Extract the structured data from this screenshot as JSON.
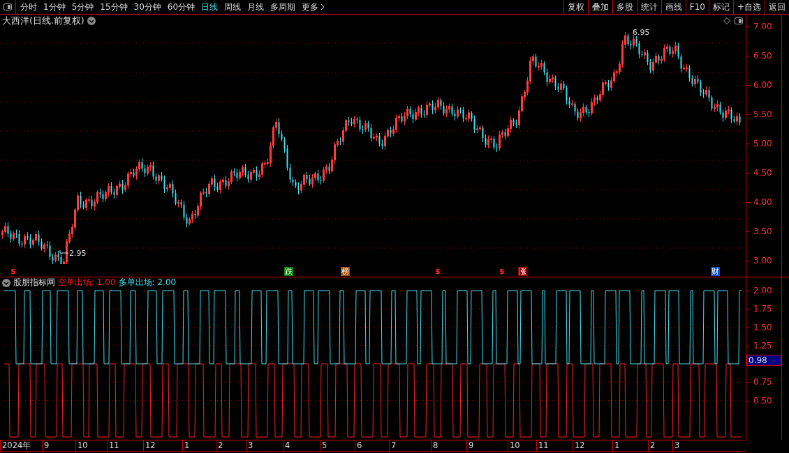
{
  "toolbar": {
    "periods": [
      {
        "label": "分时",
        "selected": false
      },
      {
        "label": "1分钟",
        "selected": false
      },
      {
        "label": "5分钟",
        "selected": false
      },
      {
        "label": "15分钟",
        "selected": false
      },
      {
        "label": "30分钟",
        "selected": false
      },
      {
        "label": "60分钟",
        "selected": false
      },
      {
        "label": "日线",
        "selected": true
      },
      {
        "label": "周线",
        "selected": false
      },
      {
        "label": "月线",
        "selected": false
      },
      {
        "label": "多周期",
        "selected": false
      }
    ],
    "more": "更多",
    "buttons": [
      "复权",
      "叠加",
      "多股",
      "统计",
      "画线",
      "F10",
      "标记",
      "+自选",
      "返回"
    ]
  },
  "price_chart": {
    "title": "大西洋(日线.前复权)",
    "axis_ticks": [
      "7.00",
      "6.50",
      "6.00",
      "5.50",
      "5.00",
      "4.50",
      "4.00",
      "3.50",
      "3.00"
    ],
    "high_label": "6.95",
    "low_label": "2.95",
    "event_markers": [
      {
        "label": "$",
        "color": "#ff2020"
      },
      {
        "label": "跌",
        "color": "#008000"
      },
      {
        "label": "榜",
        "color": "#a05010"
      },
      {
        "label": "$",
        "color": "#ff2020"
      },
      {
        "label": "$",
        "color": "#ff2020"
      },
      {
        "label": "涨",
        "color": "#900000"
      },
      {
        "label": "财",
        "color": "#1050c0"
      }
    ]
  },
  "indicator": {
    "name": "股朋指标网",
    "series": [
      {
        "label": "空单出场: 1.00",
        "color": "#ff2020"
      },
      {
        "label": "多单出场: 2.00",
        "color": "#40e0f0"
      }
    ],
    "axis_ticks": [
      "2.00",
      "1.75",
      "1.50",
      "1.25",
      "0.75",
      "0.50"
    ],
    "cursor_value": "0.98"
  },
  "date_axis": [
    "2024年",
    "9",
    "10",
    "11",
    "12",
    "1",
    "2",
    "3",
    "4",
    "5",
    "6",
    "7",
    "8",
    "9",
    "10",
    "11",
    "12",
    "1",
    "2",
    "3"
  ]
}
